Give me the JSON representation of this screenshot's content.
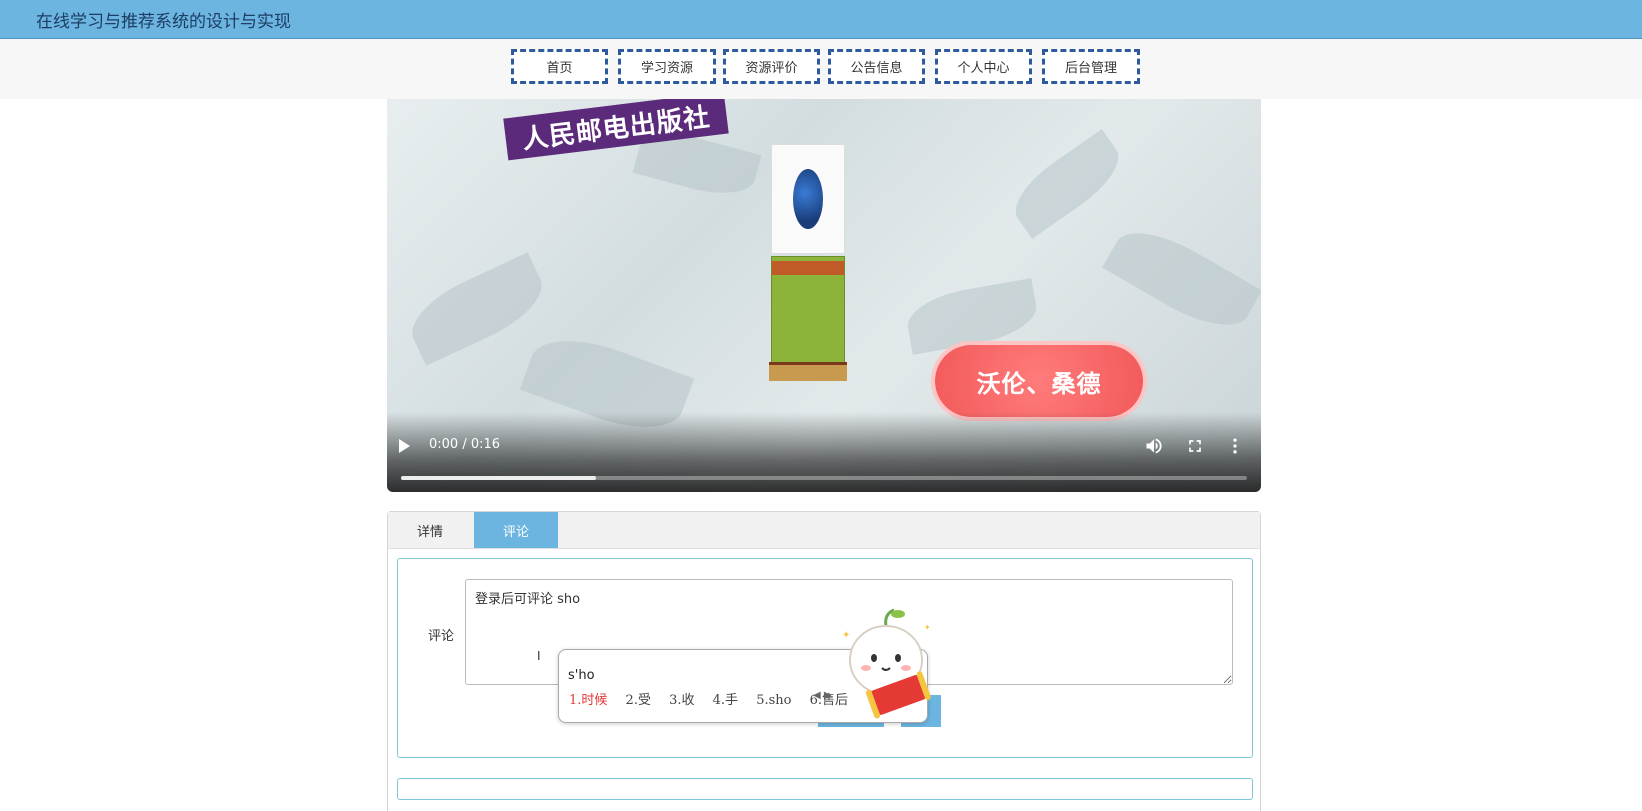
{
  "site": {
    "title": "在线学习与推荐系统的设计与实现"
  },
  "nav": {
    "items": [
      {
        "label": "首页"
      },
      {
        "label": "学习资源"
      },
      {
        "label": "资源评价"
      },
      {
        "label": "公告信息"
      },
      {
        "label": "个人中心"
      },
      {
        "label": "后台管理"
      }
    ]
  },
  "video": {
    "publisher_text": "人民邮电出版社",
    "author_text": "沃伦、桑德",
    "time_display": "0:00 / 0:16",
    "buffered_fraction": 0.23,
    "icons": [
      "play-icon",
      "volume-icon",
      "fullscreen-icon",
      "more-icon"
    ]
  },
  "tabs": [
    {
      "label": "详情",
      "active": false
    },
    {
      "label": "评论",
      "active": true
    }
  ],
  "comment": {
    "label": "评论",
    "textarea_value": "登录后可评论 sho"
  },
  "ime": {
    "input": "s'ho",
    "candidates": [
      "1.时候",
      "2.受",
      "3.收",
      "4.手",
      "5.sho",
      "6.售后"
    ]
  },
  "colors": {
    "header_bg": "#6bb5e0",
    "nav_border": "#2e5aa0",
    "accent": "#6bb5e0",
    "panel_border": "#7ec6d8",
    "ime_active": "#e53935"
  }
}
